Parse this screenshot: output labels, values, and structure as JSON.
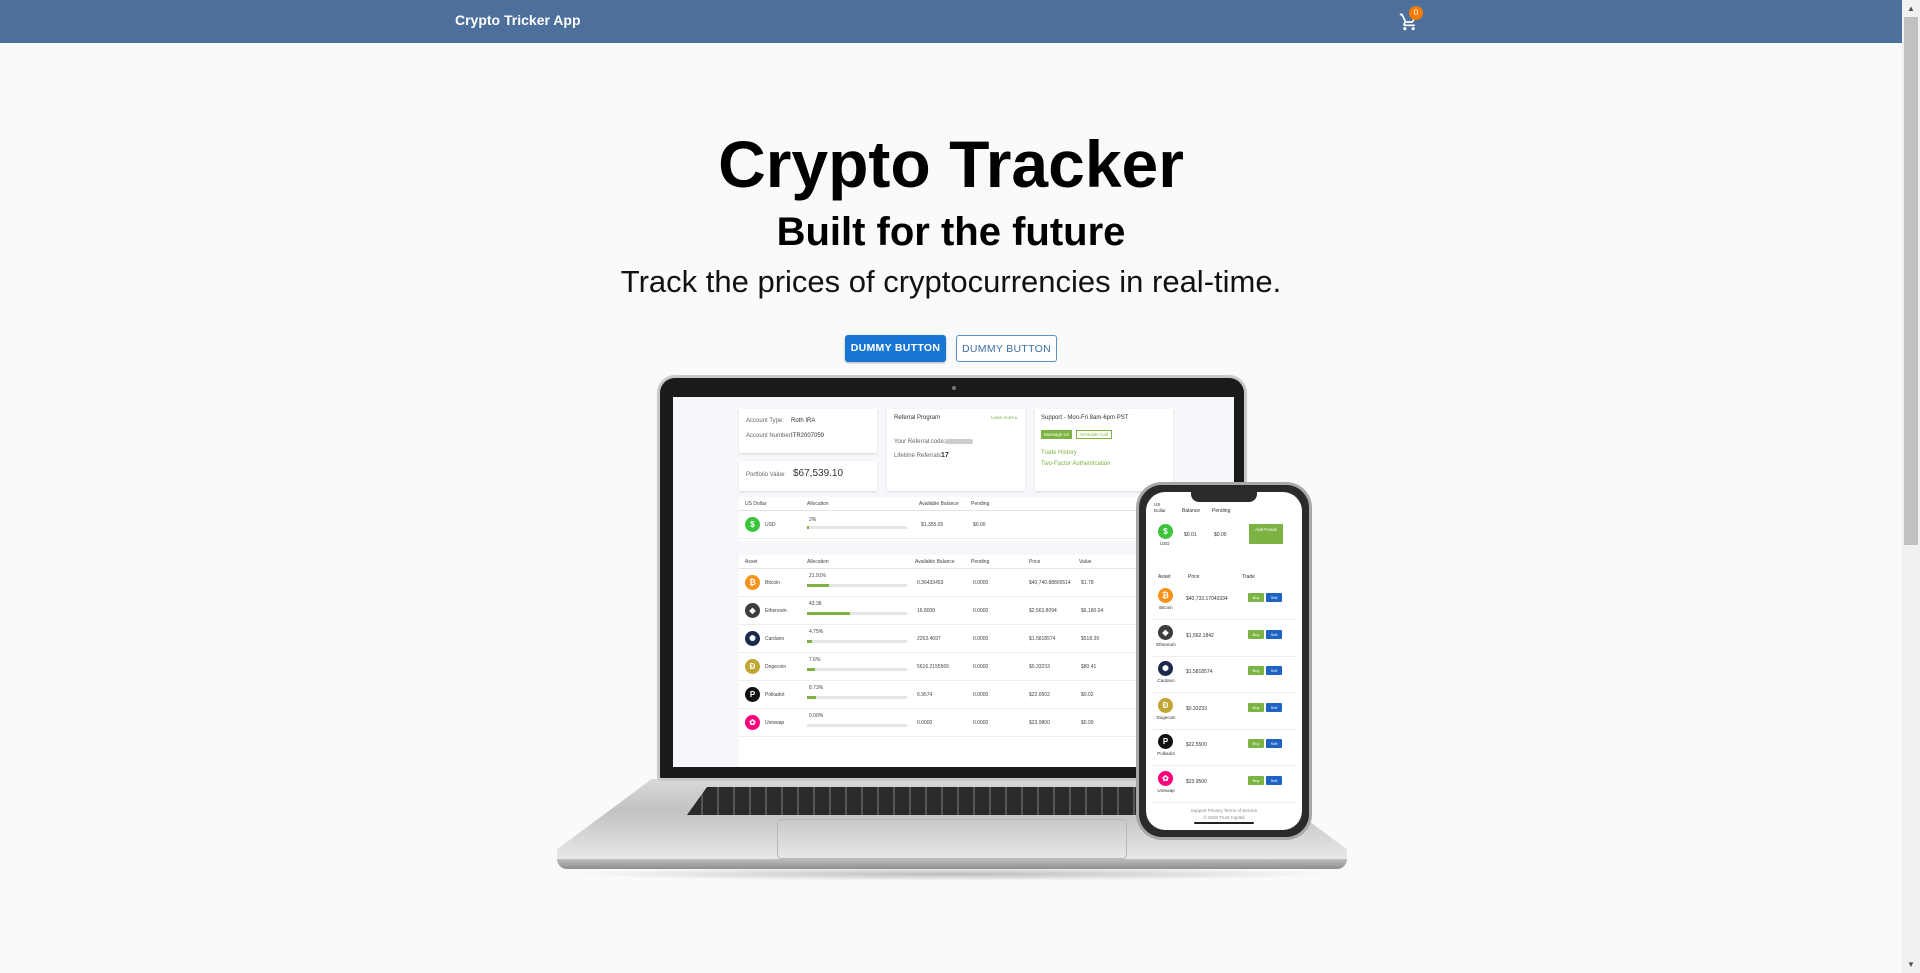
{
  "header": {
    "brand": "Crypto Tricker App",
    "cart_count": "0"
  },
  "hero": {
    "title": "Crypto Tracker",
    "subtitle": "Built for the future",
    "description": "Track the prices of cryptocurrencies in real-time.",
    "primary_button": "DUMMY BUTTON",
    "secondary_button": "DUMMY BUTTON"
  },
  "laptop_screen": {
    "account_type_label": "Account Type:",
    "account_type": "Roth IRA",
    "account_number_label": "Account Number:",
    "account_number": "ITR2007059",
    "portfolio_label": "Portfolio Value",
    "portfolio_value": "$67,539.10",
    "referral_title": "Referral Program",
    "learn_more": "Learn more ▸",
    "referral_code_label": "Your Referral code:",
    "lifetime_label": "Lifetime Referrals:",
    "lifetime_value": "17",
    "support_title": "Support - Mon-Fri 8am-6pm PST",
    "message_us": "Message Us",
    "schedule_call": "Schedule Call",
    "trade_history": "Trade History",
    "two_factor": "Two-Factor Authentication",
    "usd_headers": [
      "US Dollar",
      "Allocation",
      "Available Balance",
      "Pending"
    ],
    "usd_row": {
      "name": "USD",
      "allocation": "2%",
      "balance": "$1,355.05",
      "pending": "$0.00"
    },
    "asset_headers": [
      "Asset",
      "Allocation",
      "Available Balance",
      "Pending",
      "Price",
      "Value"
    ],
    "assets": [
      {
        "name": "Bitcoin",
        "allocation": "21.91%",
        "balance": "0.36433453",
        "pending": "0.0000",
        "price": "$40,740.88800514",
        "value": "$1.78"
      },
      {
        "name": "Ethereum",
        "allocation": "43.38",
        "balance": "16.8008",
        "pending": "0.0000",
        "price": "$2,563.8094",
        "value": "$6,180.04"
      },
      {
        "name": "Cardano",
        "allocation": "4.75%",
        "balance": "2263.4697",
        "pending": "0.0000",
        "price": "$1.5818574",
        "value": "$518.39"
      },
      {
        "name": "Dogecoin",
        "allocation": "7.6%",
        "balance": "5616.2155565",
        "pending": "0.0000",
        "price": "$0.33233",
        "value": "$80.41"
      },
      {
        "name": "Polkadot",
        "allocation": "8.73%",
        "balance": "6.9574",
        "pending": "0.0000",
        "price": "$22.0502",
        "value": "$0.02"
      },
      {
        "name": "Uniswap",
        "allocation": "0.00%",
        "balance": "0.0000",
        "pending": "0.0000",
        "price": "$23.9800",
        "value": "$0.00"
      }
    ],
    "asset_colors": [
      "#f7931a",
      "#3c3c3d",
      "#1b2a4a",
      "#c2a633",
      "#111111",
      "#ff007a"
    ],
    "asset_glyphs": [
      "₿",
      "◆",
      "✺",
      "Ð",
      "P",
      "✿"
    ]
  },
  "phone_screen": {
    "usd_headers": [
      "US Dollar",
      "Balance",
      "Pending"
    ],
    "usd": {
      "name": "USD",
      "balance": "$0.01",
      "pending": "$0.00",
      "add_funds": "Add Funds"
    },
    "asset_headers": [
      "Asset",
      "Price",
      "Trade"
    ],
    "buy": "Buy",
    "sell": "Sell",
    "assets": [
      {
        "name": "Bitcoin",
        "price": "$40,733.17040334"
      },
      {
        "name": "Ethereum",
        "price": "$1,562.1842"
      },
      {
        "name": "Cardano",
        "price": "$1.5818574"
      },
      {
        "name": "Dogecoin",
        "price": "$0.33233"
      },
      {
        "name": "Polkadot",
        "price": "$22.5500"
      },
      {
        "name": "Uniswap",
        "price": "$23.9500"
      }
    ],
    "footer_links": "Support   Privacy   Terms of Service",
    "copyright": "© 2020 Trust Capital"
  }
}
